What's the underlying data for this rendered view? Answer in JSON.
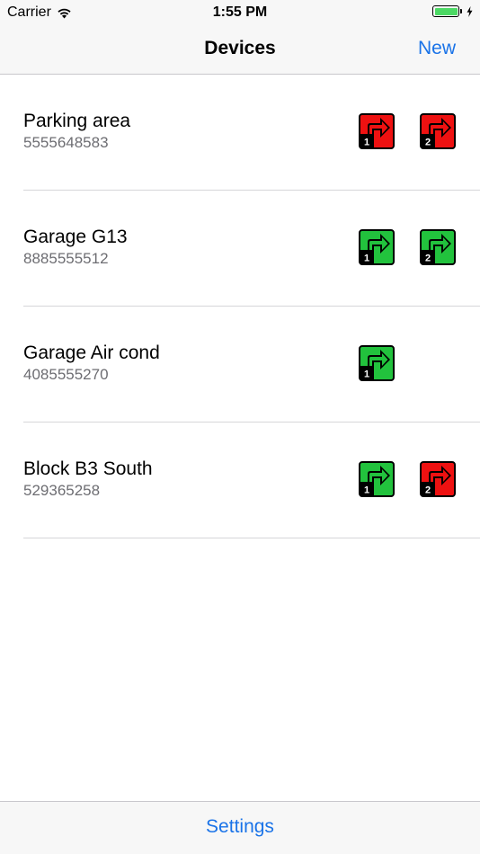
{
  "status_bar": {
    "carrier": "Carrier",
    "time": "1:55 PM"
  },
  "nav": {
    "title": "Devices",
    "new_label": "New"
  },
  "colors": {
    "relay_on": "#22c23d",
    "relay_off": "#ee1111",
    "tint": "#1a73e8"
  },
  "devices": [
    {
      "name": "Parking area",
      "phone": "5555648583",
      "relays": [
        {
          "number": "1",
          "state": "off",
          "icon": "relay-arrow-icon"
        },
        {
          "number": "2",
          "state": "off",
          "icon": "relay-arrow-icon"
        }
      ]
    },
    {
      "name": "Garage G13",
      "phone": "8885555512",
      "relays": [
        {
          "number": "1",
          "state": "on",
          "icon": "relay-arrow-icon"
        },
        {
          "number": "2",
          "state": "on",
          "icon": "relay-arrow-icon"
        }
      ]
    },
    {
      "name": "Garage Air cond",
      "phone": "4085555270",
      "relays": [
        {
          "number": "1",
          "state": "on",
          "icon": "relay-arrow-icon"
        }
      ]
    },
    {
      "name": "Block B3 South",
      "phone": "529365258",
      "relays": [
        {
          "number": "1",
          "state": "on",
          "icon": "relay-arrow-icon"
        },
        {
          "number": "2",
          "state": "off",
          "icon": "relay-arrow-icon"
        }
      ]
    }
  ],
  "tab_bar": {
    "settings_label": "Settings"
  }
}
